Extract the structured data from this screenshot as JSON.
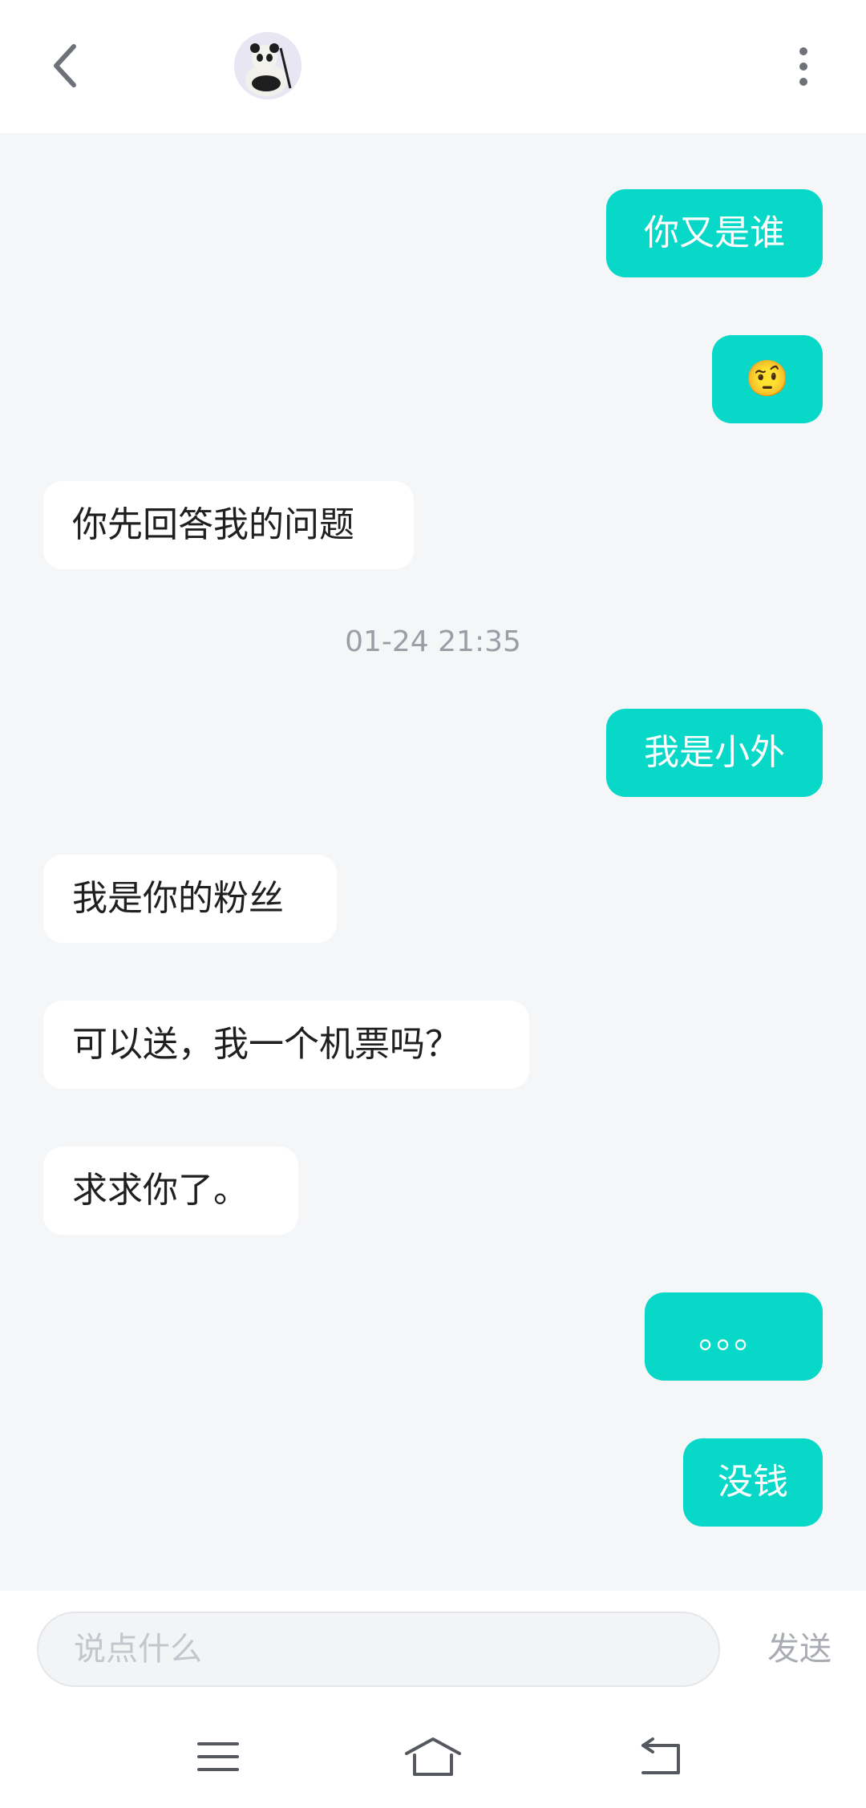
{
  "header": {
    "back_icon": "chevron-left-icon",
    "avatar_icon": "panda-avatar",
    "more_icon": "more-vertical-icon"
  },
  "messages": [
    {
      "side": "out",
      "text": "你又是谁"
    },
    {
      "side": "out",
      "text": "🤨"
    },
    {
      "side": "in",
      "text": "你先回答我的问题"
    },
    {
      "side": "out",
      "text": "我是小外"
    },
    {
      "side": "in",
      "text": "我是你的粉丝"
    },
    {
      "side": "in",
      "text": "可以送，我一个机票吗？"
    },
    {
      "side": "in",
      "text": "求求你了。"
    },
    {
      "side": "out",
      "text": "。。。"
    },
    {
      "side": "out",
      "text": "没钱"
    }
  ],
  "timestamp": "01-24 21:35",
  "input": {
    "placeholder": "说点什么",
    "send_label": "发送"
  },
  "colors": {
    "outgoing_bubble": "#08d8c8",
    "incoming_bubble": "#ffffff",
    "chat_background": "#f5f6f8"
  },
  "system_nav": [
    "menu-icon",
    "home-icon",
    "back-icon"
  ]
}
